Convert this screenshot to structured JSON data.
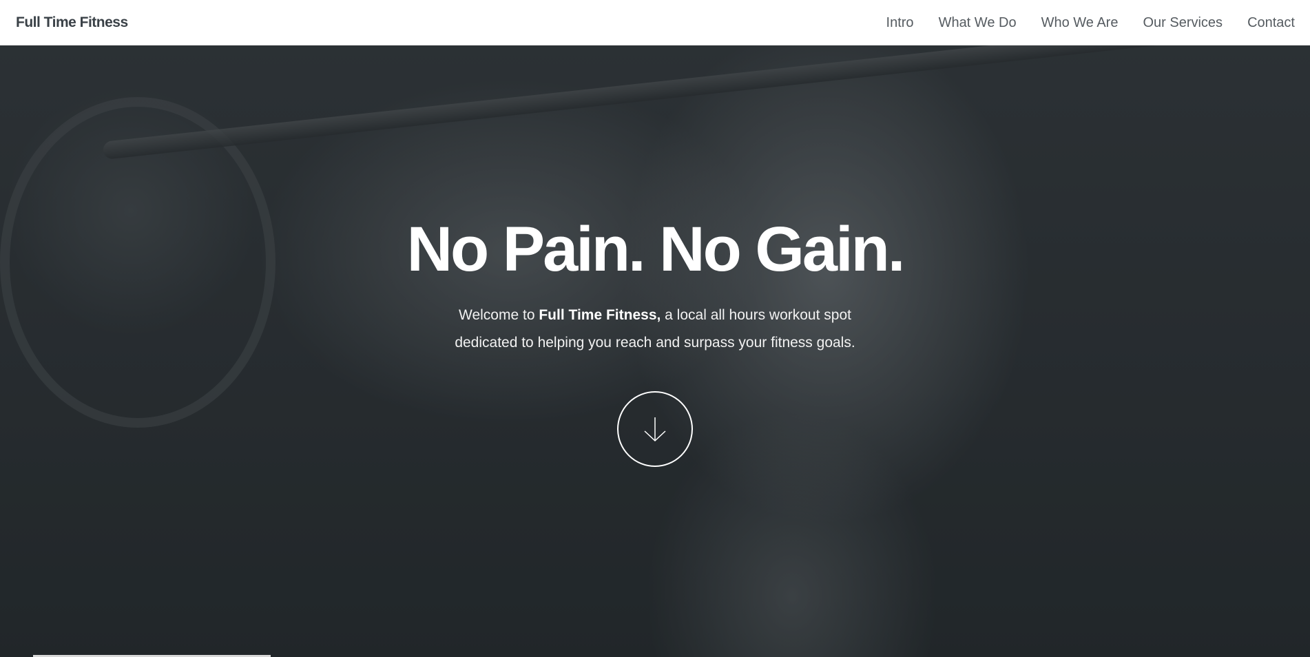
{
  "header": {
    "brand": "Full Time Fitness",
    "nav": [
      {
        "label": "Intro"
      },
      {
        "label": "What We Do"
      },
      {
        "label": "Who We Are"
      },
      {
        "label": "Our Services"
      },
      {
        "label": "Contact"
      }
    ]
  },
  "hero": {
    "title": "No Pain. No Gain.",
    "subtitle_prefix": "Welcome to ",
    "subtitle_brand": "Full Time Fitness,",
    "subtitle_suffix": " a local all hours workout spot dedicated to helping you reach and surpass your fitness goals.",
    "scroll_icon": "arrow-down-icon"
  }
}
